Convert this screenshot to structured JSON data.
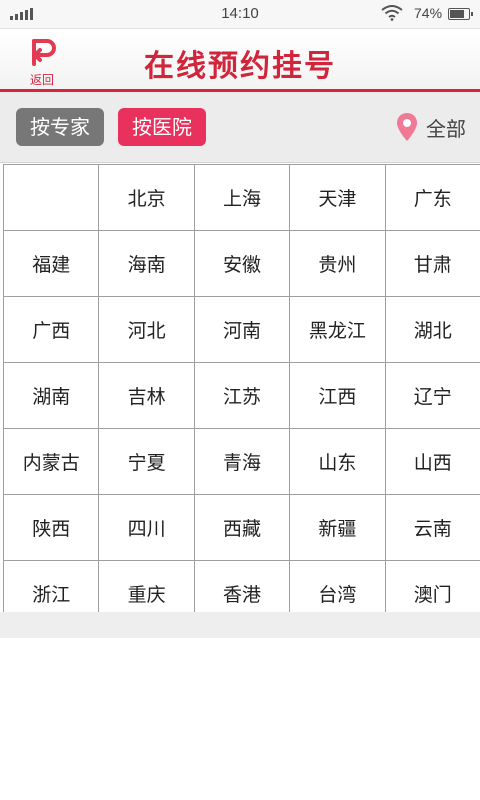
{
  "status_bar": {
    "time": "14:10",
    "battery": "74%"
  },
  "header": {
    "back_label": "返回",
    "title": "在线预约挂号"
  },
  "filters": {
    "by_expert": "按专家",
    "by_hospital": "按医院",
    "region": "全部"
  },
  "regions": [
    [
      "",
      "北京",
      "上海",
      "天津",
      "广东"
    ],
    [
      "福建",
      "海南",
      "安徽",
      "贵州",
      "甘肃"
    ],
    [
      "广西",
      "河北",
      "河南",
      "黑龙江",
      "湖北"
    ],
    [
      "湖南",
      "吉林",
      "江苏",
      "江西",
      "辽宁"
    ],
    [
      "内蒙古",
      "宁夏",
      "青海",
      "山东",
      "山西"
    ],
    [
      "陕西",
      "四川",
      "西藏",
      "新疆",
      "云南"
    ],
    [
      "浙江",
      "重庆",
      "香港",
      "台湾",
      "澳门"
    ]
  ],
  "colors": {
    "accent": "#d8253d",
    "active_chip": "#e8315c",
    "inactive_chip": "#777777"
  }
}
